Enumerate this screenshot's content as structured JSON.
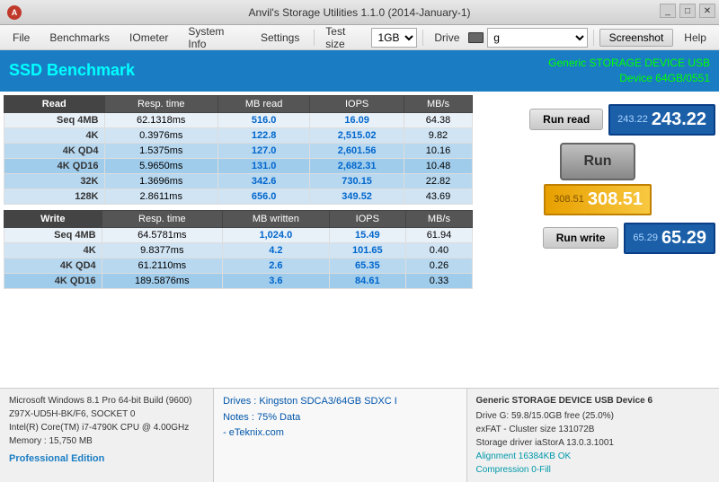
{
  "window": {
    "title": "Anvil's Storage Utilities 1.1.0 (2014-January-1)",
    "controls": [
      "_",
      "□",
      "✕"
    ]
  },
  "menu": {
    "items": [
      "File",
      "Benchmarks",
      "IOmeter",
      "System Info",
      "Settings"
    ],
    "test_size_label": "Test size",
    "test_size_value": "1GB",
    "drive_label": "Drive",
    "drive_value": "g",
    "screenshot_label": "Screenshot",
    "help_label": "Help"
  },
  "ssd": {
    "title": "SSD Benchmark",
    "device_line1": "Generic STORAGE DEVICE USB",
    "device_line2": "Device 64GB/0551"
  },
  "read_table": {
    "headers": [
      "Read",
      "Resp. time",
      "MB read",
      "IOPS",
      "MB/s"
    ],
    "rows": [
      {
        "label": "Seq 4MB",
        "resp": "62.1318ms",
        "mb": "516.0",
        "iops": "16.09",
        "mbs": "64.38",
        "style": "row-alt1"
      },
      {
        "label": "4K",
        "resp": "0.3976ms",
        "mb": "122.8",
        "iops": "2,515.02",
        "mbs": "9.82",
        "style": "row-alt2"
      },
      {
        "label": "4K QD4",
        "resp": "1.5375ms",
        "mb": "127.0",
        "iops": "2,601.56",
        "mbs": "10.16",
        "style": "row-alt3"
      },
      {
        "label": "4K QD16",
        "resp": "5.9650ms",
        "mb": "131.0",
        "iops": "2,682.31",
        "mbs": "10.48",
        "style": "row-alt4"
      },
      {
        "label": "32K",
        "resp": "1.3696ms",
        "mb": "342.6",
        "iops": "730.15",
        "mbs": "22.82",
        "style": "row-alt3"
      },
      {
        "label": "128K",
        "resp": "2.8611ms",
        "mb": "656.0",
        "iops": "349.52",
        "mbs": "43.69",
        "style": "row-alt2"
      }
    ]
  },
  "write_table": {
    "headers": [
      "Write",
      "Resp. time",
      "MB written",
      "IOPS",
      "MB/s"
    ],
    "rows": [
      {
        "label": "Seq 4MB",
        "resp": "64.5781ms",
        "mb": "1,024.0",
        "iops": "15.49",
        "mbs": "61.94",
        "style": "row-alt1"
      },
      {
        "label": "4K",
        "resp": "9.8377ms",
        "mb": "4.2",
        "iops": "101.65",
        "mbs": "0.40",
        "style": "row-alt2"
      },
      {
        "label": "4K QD4",
        "resp": "61.2110ms",
        "mb": "2.6",
        "iops": "65.35",
        "mbs": "0.26",
        "style": "row-alt3"
      },
      {
        "label": "4K QD16",
        "resp": "189.5876ms",
        "mb": "3.6",
        "iops": "84.61",
        "mbs": "0.33",
        "style": "row-alt4"
      }
    ]
  },
  "scores": {
    "read_label": "Run read",
    "read_small": "243.22",
    "read_value": "243.22",
    "run_label": "Run",
    "total_small": "308.51",
    "total_value": "308.51",
    "write_label": "Run write",
    "write_small": "65.29",
    "write_value": "65.29"
  },
  "bottom": {
    "sys_info": [
      "Microsoft Windows 8.1 Pro 64-bit Build (9600)",
      "Z97X-UD5H-BK/F6, SOCKET 0",
      "Intel(R) Core(TM) i7-4790K CPU @ 4.00GHz",
      "Memory : 15,750 MB"
    ],
    "pro_edition": "Professional Edition",
    "drives_line1": "Drives : Kingston SDCA3/64GB SDXC I",
    "drives_line2": "Notes : 75% Data",
    "drives_line3": "- eTeknix.com",
    "storage_title": "Generic STORAGE DEVICE USB Device 6",
    "storage_lines": [
      "Drive G: 59.8/15.0GB free (25.0%)",
      "exFAT - Cluster size 131072B",
      "Storage driver  iaStorA 13.0.3.1001",
      "",
      "Alignment 16384KB OK",
      "Compression 0-Fill"
    ]
  }
}
